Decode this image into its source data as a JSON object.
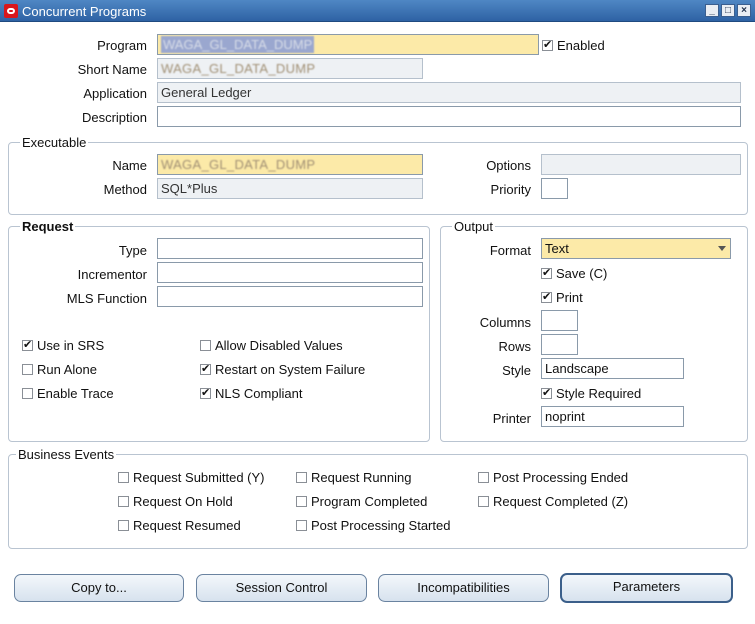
{
  "window": {
    "title": "Concurrent Programs",
    "minimize": "_",
    "maximize": "□",
    "close": "×"
  },
  "program": {
    "program_label": "Program",
    "program_value": "WAGA_GL_DATA_DUMP",
    "enabled_label": "Enabled",
    "enabled_checked": true,
    "short_name_label": "Short Name",
    "short_name_value": "WAGA_GL_DATA_DUMP",
    "application_label": "Application",
    "application_value": "General Ledger",
    "description_label": "Description",
    "description_value": ""
  },
  "executable": {
    "group_title": "Executable",
    "name_label": "Name",
    "name_value": "WAGA_GL_DATA_DUMP",
    "method_label": "Method",
    "method_value": "SQL*Plus",
    "options_label": "Options",
    "options_value": "",
    "priority_label": "Priority",
    "priority_value": ""
  },
  "request": {
    "group_title": "Request",
    "type_label": "Type",
    "incrementor_label": "Incrementor",
    "mls_label": "MLS Function",
    "checkboxes": [
      {
        "label": "Use in SRS",
        "checked": true
      },
      {
        "label": "Run Alone",
        "checked": false
      },
      {
        "label": "Enable Trace",
        "checked": false
      },
      {
        "label": "Allow Disabled Values",
        "checked": false
      },
      {
        "label": "Restart on System Failure",
        "checked": true
      },
      {
        "label": "NLS Compliant",
        "checked": true
      }
    ]
  },
  "output": {
    "group_title": "Output",
    "format_label": "Format",
    "format_value": "Text",
    "save_label": "Save (C)",
    "save_checked": true,
    "print_label": "Print",
    "print_checked": true,
    "columns_label": "Columns",
    "rows_label": "Rows",
    "style_label": "Style",
    "style_value": "Landscape",
    "style_required_label": "Style Required",
    "style_required_checked": true,
    "printer_label": "Printer",
    "printer_value": "noprint"
  },
  "business_events": {
    "group_title": "Business Events",
    "items": [
      {
        "label": "Request Submitted (Y)",
        "checked": false
      },
      {
        "label": "Request On Hold",
        "checked": false
      },
      {
        "label": "Request Resumed",
        "checked": false
      },
      {
        "label": "Request Running",
        "checked": false
      },
      {
        "label": "Program Completed",
        "checked": false
      },
      {
        "label": "Post Processing Started",
        "checked": false
      },
      {
        "label": "Post Processing Ended",
        "checked": false
      },
      {
        "label": "Request Completed (Z)",
        "checked": false
      }
    ]
  },
  "buttons": {
    "copy_to": "Copy to...",
    "session_control": "Session Control",
    "incompatibilities": "Incompatibilities",
    "parameters": "Parameters"
  }
}
